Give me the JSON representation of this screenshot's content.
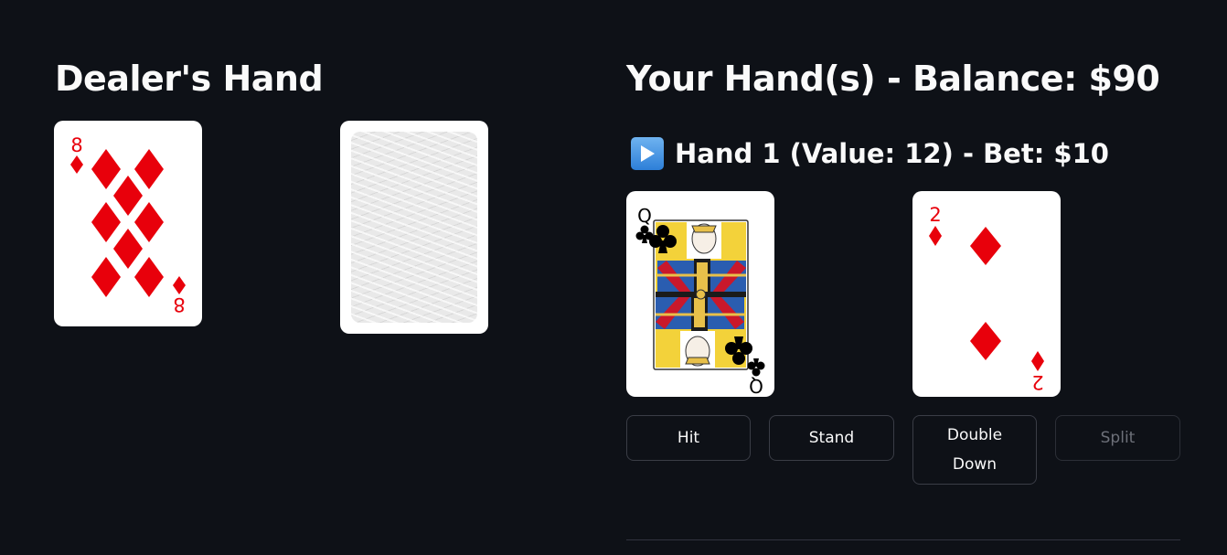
{
  "dealer": {
    "title": "Dealer's Hand",
    "cards": [
      {
        "rank": "8",
        "suit": "diamonds",
        "face_up": true
      },
      {
        "face_up": false
      }
    ]
  },
  "player": {
    "title": "Your Hand(s) - Balance: $90",
    "balance": 90,
    "hands": [
      {
        "icon": "play-button-icon",
        "title": "Hand 1 (Value: 12) - Bet: $10",
        "value": 12,
        "bet": 10,
        "active": true,
        "cards": [
          {
            "rank": "Q",
            "suit": "clubs",
            "face_up": true
          },
          {
            "rank": "2",
            "suit": "diamonds",
            "face_up": true
          }
        ]
      }
    ]
  },
  "actions": {
    "hit": "Hit",
    "stand": "Stand",
    "double_down": "Double Down",
    "split": "Split",
    "split_enabled": false
  },
  "colors": {
    "background": "#0e1117",
    "text": "#fafafa",
    "red_suit": "#e8000b",
    "black_suit": "#000000",
    "button_border": "#3a3d46",
    "disabled_text": "#6d7079"
  }
}
